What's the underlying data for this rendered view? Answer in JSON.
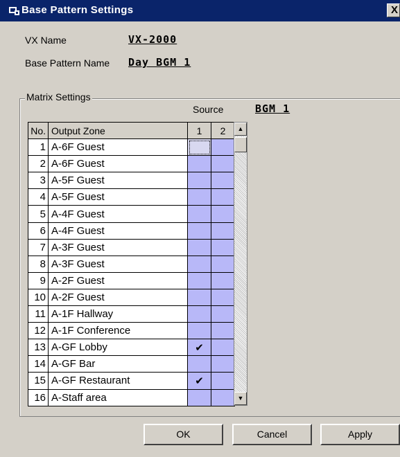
{
  "window": {
    "title": "Base Pattern Settings",
    "close_symbol": "X"
  },
  "fields": {
    "vx_name_label": "VX Name",
    "vx_name_value": "VX-2000",
    "base_pattern_label": "Base Pattern Name",
    "base_pattern_value": "Day BGM 1"
  },
  "matrix": {
    "group_label": "Matrix Settings",
    "source_label": "Source",
    "source_value": "BGM 1",
    "headers": {
      "no": "No.",
      "zone": "Output Zone",
      "src1": "1",
      "src2": "2"
    },
    "rows": [
      {
        "no": "1",
        "zone": "A-6F Guest",
        "c1": "",
        "c2": ""
      },
      {
        "no": "2",
        "zone": "A-6F Guest",
        "c1": "",
        "c2": ""
      },
      {
        "no": "3",
        "zone": "A-5F Guest",
        "c1": "",
        "c2": ""
      },
      {
        "no": "4",
        "zone": "A-5F Guest",
        "c1": "",
        "c2": ""
      },
      {
        "no": "5",
        "zone": "A-4F Guest",
        "c1": "",
        "c2": ""
      },
      {
        "no": "6",
        "zone": "A-4F Guest",
        "c1": "",
        "c2": ""
      },
      {
        "no": "7",
        "zone": "A-3F Guest",
        "c1": "",
        "c2": ""
      },
      {
        "no": "8",
        "zone": "A-3F Guest",
        "c1": "",
        "c2": ""
      },
      {
        "no": "9",
        "zone": "A-2F Guest",
        "c1": "",
        "c2": ""
      },
      {
        "no": "10",
        "zone": "A-2F Guest",
        "c1": "",
        "c2": ""
      },
      {
        "no": "11",
        "zone": "A-1F Hallway",
        "c1": "",
        "c2": ""
      },
      {
        "no": "12",
        "zone": "A-1F Conference",
        "c1": "",
        "c2": ""
      },
      {
        "no": "13",
        "zone": "A-GF Lobby",
        "c1": "✔",
        "c2": ""
      },
      {
        "no": "14",
        "zone": "A-GF Bar",
        "c1": "",
        "c2": ""
      },
      {
        "no": "15",
        "zone": "A-GF Restaurant",
        "c1": "✔",
        "c2": ""
      },
      {
        "no": "16",
        "zone": "A-Staff area",
        "c1": "",
        "c2": ""
      }
    ]
  },
  "buttons": {
    "ok": "OK",
    "cancel": "Cancel",
    "apply": "Apply"
  },
  "colors": {
    "titlebar": "#0a246a",
    "cell": "#b8b8f8",
    "face": "#d4d0c8"
  }
}
